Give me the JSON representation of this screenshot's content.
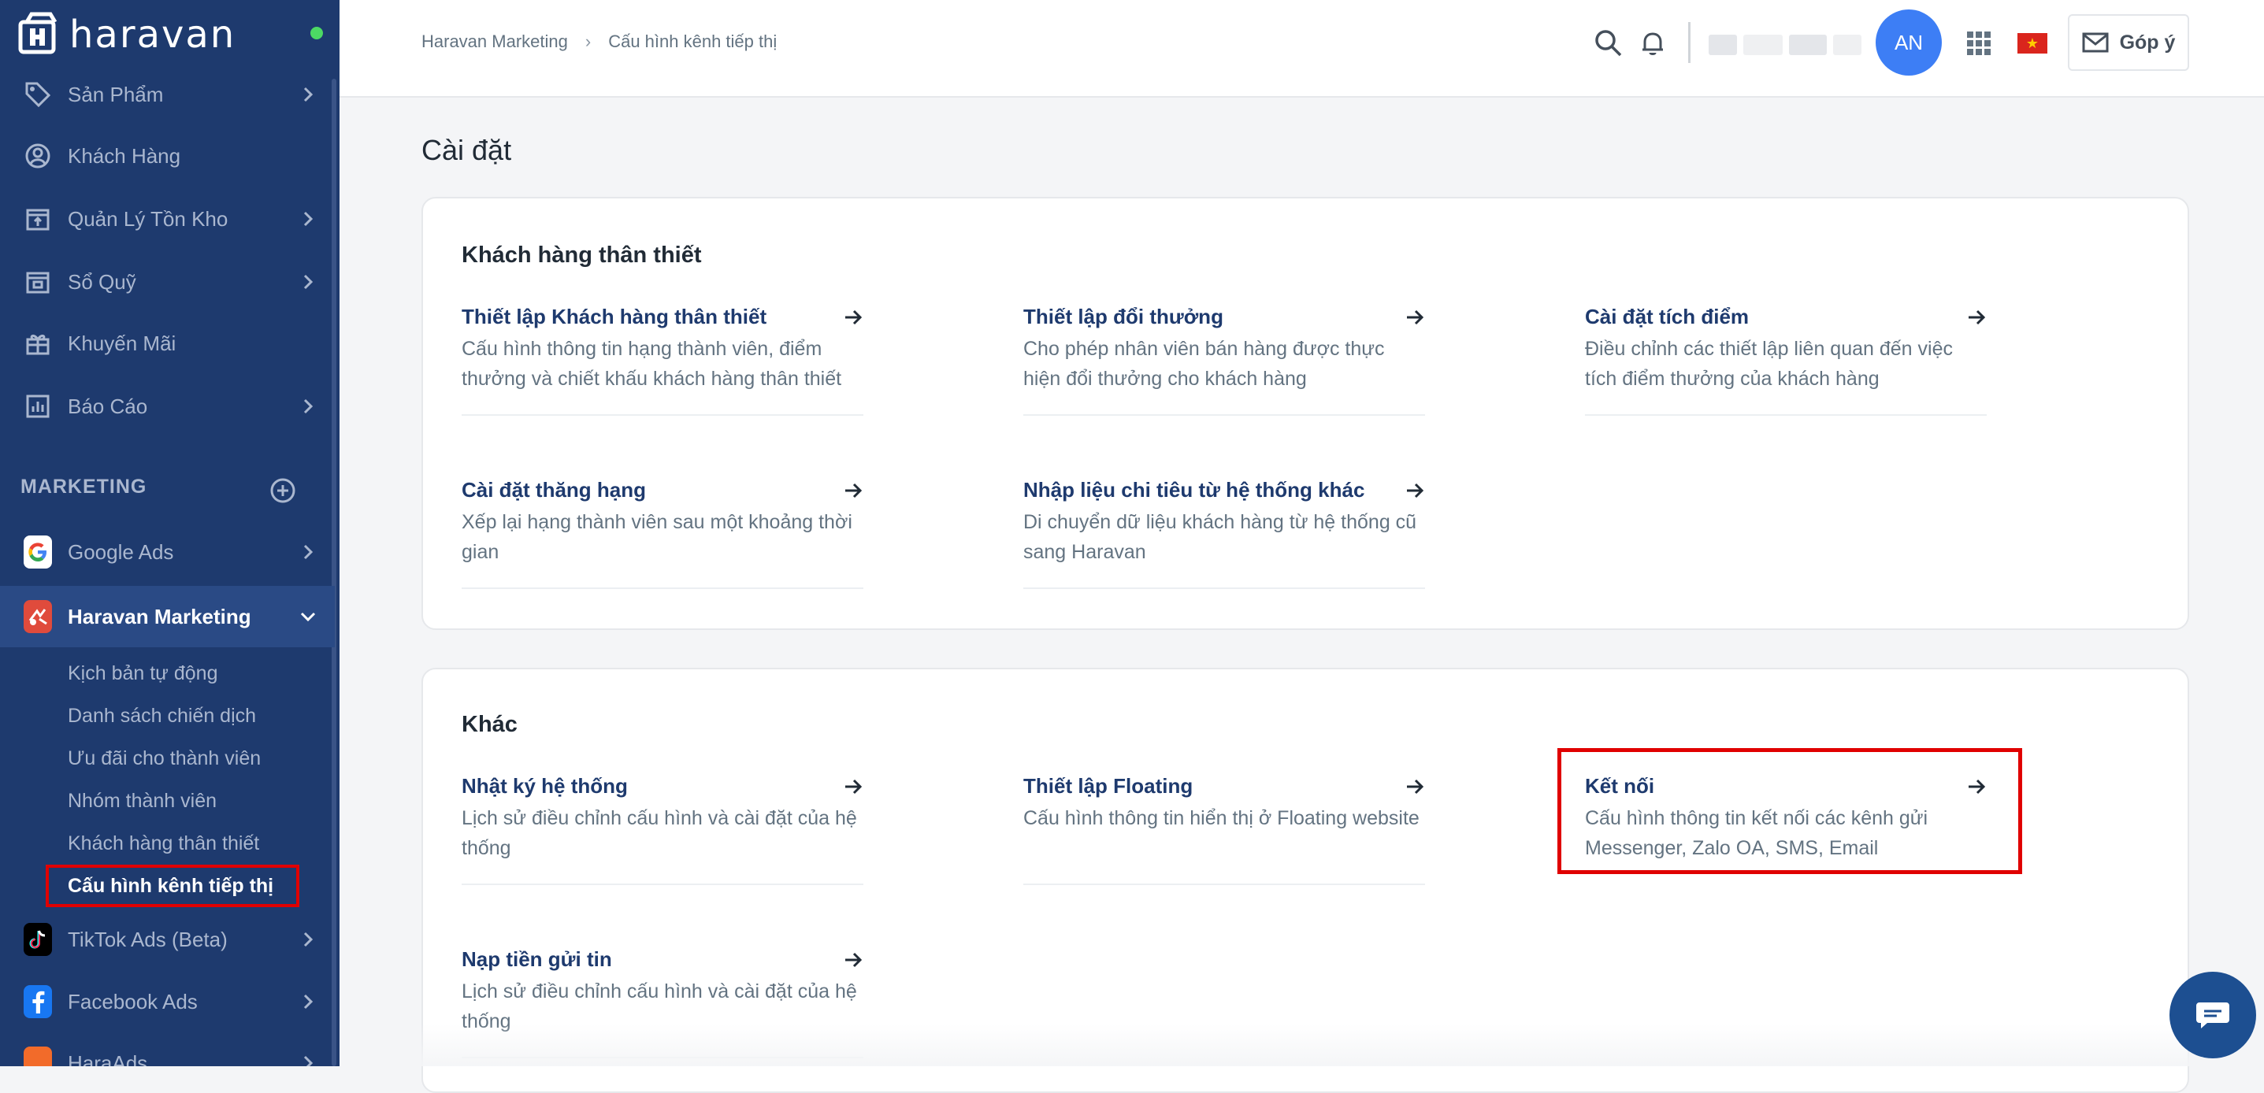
{
  "brand": {
    "name": "haravan"
  },
  "sidebar": {
    "items": [
      {
        "label": "Sản Phẩm",
        "icon": "tag-icon",
        "has_chevron": true
      },
      {
        "label": "Khách Hàng",
        "icon": "user-circle-icon",
        "has_chevron": false
      },
      {
        "label": "Quản Lý Tồn Kho",
        "icon": "warehouse-icon",
        "has_chevron": true
      },
      {
        "label": "Sổ Quỹ",
        "icon": "cashbook-icon",
        "has_chevron": true
      },
      {
        "label": "Khuyến Mãi",
        "icon": "gift-icon",
        "has_chevron": false
      },
      {
        "label": "Báo Cáo",
        "icon": "bar-chart-icon",
        "has_chevron": true
      }
    ],
    "marketing_section": "MARKETING",
    "channels": [
      {
        "label": "Google Ads",
        "icon": "google-icon"
      },
      {
        "label": "Haravan Marketing",
        "icon": "haravan-marketing-icon"
      },
      {
        "label": "TikTok Ads (Beta)",
        "icon": "tiktok-icon"
      },
      {
        "label": "Facebook Ads",
        "icon": "facebook-icon"
      },
      {
        "label": "HaraAds",
        "icon": "haraads-icon"
      }
    ],
    "sub_items": [
      "Kịch bản tự động",
      "Danh sách chiến dịch",
      "Ưu đãi cho thành viên",
      "Nhóm thành viên",
      "Khách hàng thân thiết",
      "Cấu hình kênh tiếp thị"
    ]
  },
  "topbar": {
    "breadcrumb": [
      "Haravan Marketing",
      "Cấu hình kênh tiếp thị"
    ],
    "avatar_initials": "AN",
    "flag": "★",
    "feedback_label": "Góp ý"
  },
  "main": {
    "title": "Cài đặt",
    "sections": [
      {
        "title": "Khách hàng thân thiết",
        "items": [
          {
            "title": "Thiết lập Khách hàng thân thiết",
            "desc": "Cấu hình thông tin hạng thành viên, điểm thưởng và chiết khấu khách hàng thân thiết"
          },
          {
            "title": "Thiết lập đổi thưởng",
            "desc": "Cho phép nhân viên bán hàng được thực hiện đổi thưởng cho khách hàng"
          },
          {
            "title": "Cài đặt tích điểm",
            "desc": "Điều chỉnh các thiết lập liên quan đến việc tích điểm thưởng của khách hàng"
          },
          {
            "title": "Cài đặt thăng hạng",
            "desc": "Xếp lại hạng thành viên sau một khoảng thời gian"
          },
          {
            "title": "Nhập liệu chi tiêu từ hệ thống khác",
            "desc": "Di chuyển dữ liệu khách hàng từ hệ thống cũ sang Haravan"
          }
        ]
      },
      {
        "title": "Khác",
        "items": [
          {
            "title": "Nhật ký hệ thống",
            "desc": "Lịch sử điều chỉnh cấu hình và cài đặt của hệ thống"
          },
          {
            "title": "Thiết lập Floating",
            "desc": "Cấu hình thông tin hiển thị ở Floating website"
          },
          {
            "title": "Kết nối",
            "desc": "Cấu hình thông tin kết nối các kênh gửi Messenger, Zalo OA, SMS, Email"
          },
          {
            "title": "Nạp tiền gửi tin",
            "desc": "Lịch sử điều chỉnh cấu hình và cài đặt của hệ thống"
          }
        ]
      }
    ]
  },
  "colors": {
    "sidebar_bg": "#1e3a6e",
    "accent": "#3d7ef5",
    "highlight": "#e00000"
  }
}
